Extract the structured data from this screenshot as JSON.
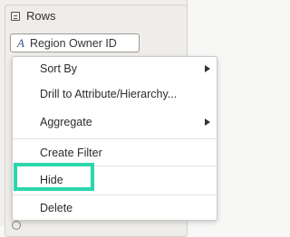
{
  "section": {
    "title": "Rows"
  },
  "row_field": {
    "label": "Region Owner ID",
    "type_icon": "A"
  },
  "context_menu": {
    "sort_by": "Sort By",
    "drill": "Drill to Attribute/Hierarchy...",
    "aggregate": "Aggregate",
    "create_filter": "Create Filter",
    "hide": "Hide",
    "delete": "Delete"
  },
  "colors": {
    "highlight": "#2bd6ad"
  }
}
